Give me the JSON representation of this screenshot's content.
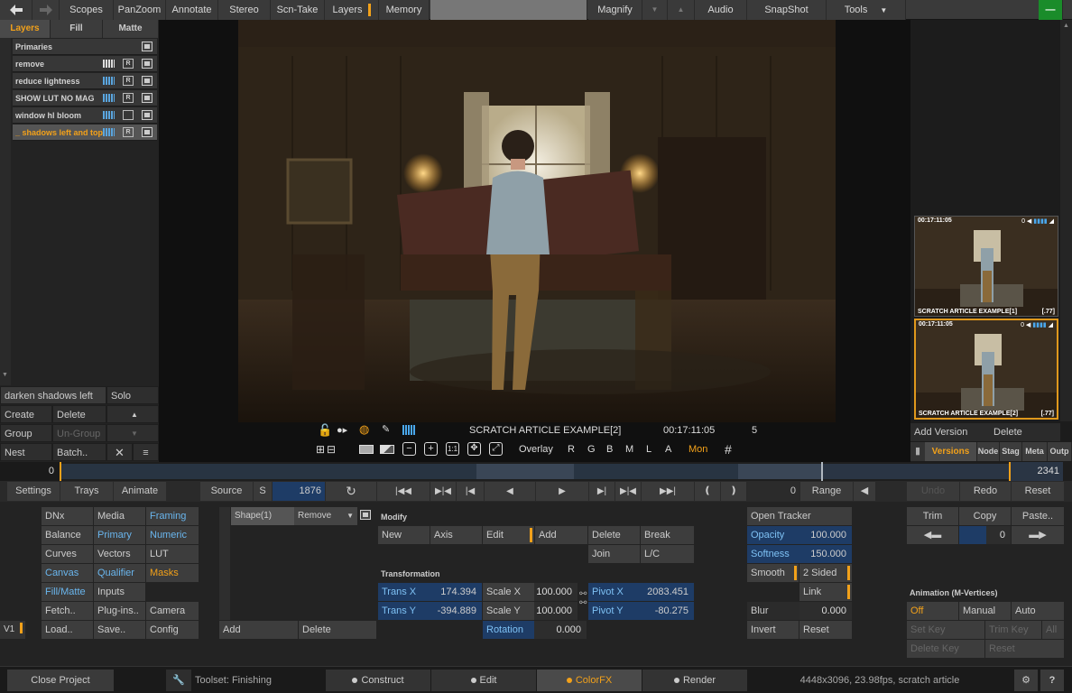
{
  "topbar": {
    "back_icon": "back-arrow-icon",
    "items": [
      "Scopes",
      "PanZoom",
      "Annotate",
      "Stereo",
      "Scn-Take",
      "Layers",
      "Memory",
      "Magnify",
      "Audio",
      "SnapShot",
      "Tools"
    ],
    "minus_label": "—"
  },
  "left": {
    "tabs": [
      "Layers",
      "Fill",
      "Matte"
    ],
    "layers": [
      "Primaries",
      "remove",
      "reduce lightness",
      "SHOW LUT NO MAG",
      "window hl bloom",
      "_ shadows left and top"
    ],
    "r_label": "R",
    "layer_name_field": "darken shadows left and",
    "solo": "Solo",
    "create": "Create",
    "delete": "Delete",
    "group": "Group",
    "ungroup": "Un-Group",
    "nest": "Nest",
    "batch": "Batch.."
  },
  "viewer": {
    "clip_name": "SCRATCH ARTICLE EXAMPLE[2]",
    "timecode": "00:17:11:05",
    "count": "5",
    "overlay": "Overlay",
    "channels": [
      "R",
      "G",
      "B",
      "M",
      "L",
      "A"
    ],
    "mon": "Mon",
    "one_to_one": "1:1"
  },
  "right": {
    "thumbs": [
      {
        "tc": "00:17:11:05",
        "name": "SCRATCH ARTICLE EXAMPLE[1]",
        "ratio": "[.77]",
        "vol": "0"
      },
      {
        "tc": "00:17:11:05",
        "name": "SCRATCH ARTICLE EXAMPLE[2]",
        "ratio": "[.77]",
        "vol": "0"
      }
    ],
    "add_version": "Add Version",
    "delete": "Delete",
    "tabs": [
      "Versions",
      "Node",
      "Stag",
      "Meta",
      "Outp"
    ]
  },
  "timeline": {
    "start": "0",
    "end": "2341"
  },
  "ctrlbar": {
    "settings": "Settings",
    "trays": "Trays",
    "animate": "Animate",
    "source": "Source",
    "s": "S",
    "frame": "1876",
    "zero": "0",
    "range": "Range",
    "undo": "Undo",
    "redo": "Redo",
    "reset": "Reset"
  },
  "bottom": {
    "grid": [
      [
        "DNx",
        "Media",
        "Framing"
      ],
      [
        "Balance",
        "Primary",
        "Numeric"
      ],
      [
        "Curves",
        "Vectors",
        "LUT"
      ],
      [
        "Canvas",
        "Qualifier",
        "Masks"
      ],
      [
        "Fill/Matte",
        "Inputs",
        ""
      ],
      [
        "Fetch..",
        "Plug-ins..",
        "Camera"
      ],
      [
        "Load..",
        "Save..",
        "Config"
      ]
    ],
    "v1": "V1",
    "shape": "Shape(1)",
    "remove": "Remove",
    "add": "Add",
    "delete": "Delete",
    "modify": "Modify",
    "mod_row1": [
      "New",
      "Axis",
      "Edit",
      "Add",
      "Delete",
      "Break"
    ],
    "mod_row2": [
      "Join",
      "L/C"
    ],
    "transformation": "Transformation",
    "trans_x": "Trans X",
    "trans_x_val": "174.394",
    "trans_y": "Trans Y",
    "trans_y_val": "-394.889",
    "scale_x": "Scale X",
    "scale_x_val": "100.000",
    "scale_y": "Scale Y",
    "scale_y_val": "100.000",
    "rotation": "Rotation",
    "rotation_val": "0.000",
    "pivot_x": "Pivot X",
    "pivot_x_val": "2083.451",
    "pivot_y": "Pivot Y",
    "pivot_y_val": "-80.275",
    "open_tracker": "Open Tracker",
    "opacity": "Opacity",
    "opacity_val": "100.000",
    "softness": "Softness",
    "softness_val": "150.000",
    "smooth": "Smooth",
    "two_sided": "2 Sided",
    "link": "Link",
    "blur": "Blur",
    "blur_val": "0.000",
    "invert": "Invert",
    "reset": "Reset",
    "trim": "Trim",
    "copy": "Copy",
    "paste": "Paste..",
    "copy_val": "0",
    "anim_header": "Animation (M-Vertices)",
    "off": "Off",
    "manual": "Manual",
    "auto": "Auto",
    "set_key": "Set Key",
    "trim_key": "Trim Key",
    "all": "All",
    "delete_key": "Delete Key",
    "reset_dim": "Reset"
  },
  "status": {
    "close_project": "Close Project",
    "toolset": "Toolset: Finishing",
    "construct": "Construct",
    "edit": "Edit",
    "colorfx": "ColorFX",
    "render": "Render",
    "info": "4448x3096, 23.98fps, scratch article",
    "help": "?"
  },
  "colors": {
    "accent": "#f2a11a",
    "blue": "#6ab6ee",
    "selected_bg": "#1e3c66"
  }
}
